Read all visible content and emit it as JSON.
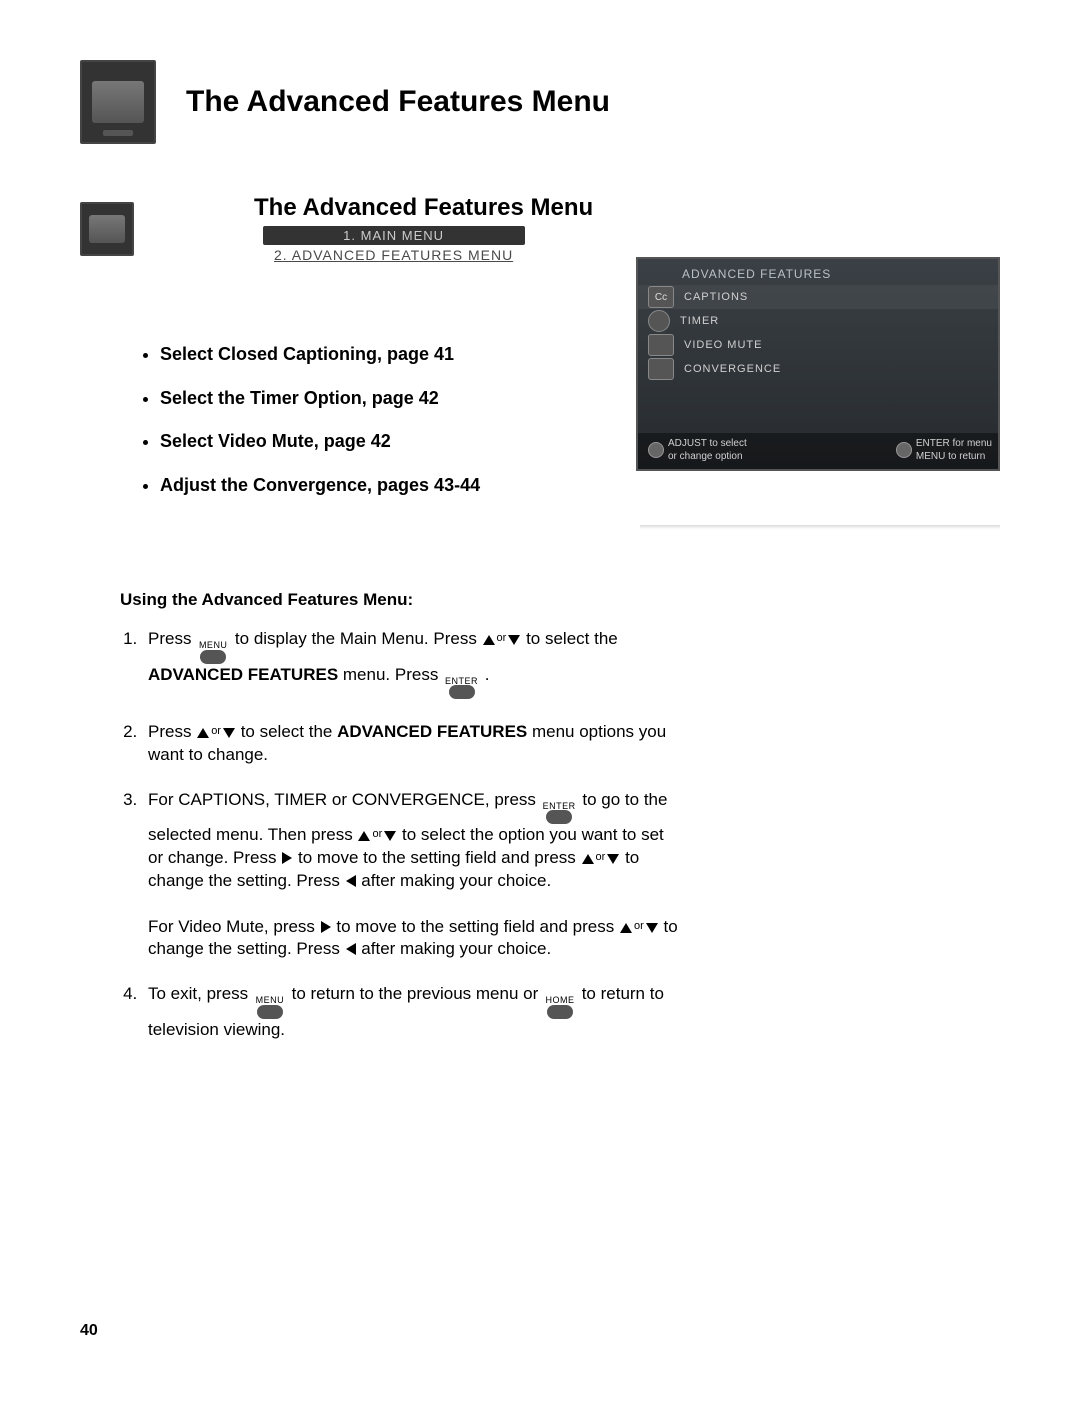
{
  "page": {
    "title": "The Advanced Features Menu",
    "subtitle": "The Advanced Features Menu",
    "breadcrumb": {
      "line1": "1. MAIN MENU",
      "line2": "2. ADVANCED FEATURES MENU"
    },
    "bullets": [
      "Select Closed Captioning, page 41",
      "Select the Timer Option, page 42",
      "Select Video Mute, page 42",
      "Adjust the Convergence, pages 43-44"
    ],
    "osd": {
      "title": "ADVANCED FEATURES",
      "items": [
        {
          "icon": "Cc",
          "label": "CAPTIONS"
        },
        {
          "icon": "",
          "label": "TIMER"
        },
        {
          "icon": "",
          "label": "VIDEO MUTE"
        },
        {
          "icon": "",
          "label": "CONVERGENCE"
        }
      ],
      "footer_left_1": "ADJUST to select",
      "footer_left_2": "or change option",
      "footer_right_1": "ENTER for menu",
      "footer_right_2": "MENU to return"
    },
    "instructions": {
      "heading": "Using the Advanced Features Menu:",
      "buttons": {
        "menu": "MENU",
        "enter": "ENTER",
        "home": "HOME"
      },
      "step1_a": "Press ",
      "step1_b": " to display the Main Menu.  Press ",
      "step1_c": " to select the ",
      "step1_d": "ADVANCED FEATURES",
      "step1_e": " menu. Press ",
      "step1_f": " .",
      "step2_a": "Press ",
      "step2_b": " to select the ",
      "step2_c": "ADVANCED FEATURES",
      "step2_d": " menu options you want to change.",
      "step3_a": "For CAPTIONS, TIMER or CONVERGENCE, press ",
      "step3_b": " to go to the selected menu.  Then press ",
      "step3_c": " to select the option you want to set or change. Press ",
      "step3_d": " to move to the setting field and press ",
      "step3_e": " to change the setting.  Press ",
      "step3_f": " after making your choice.",
      "step3_g": "For Video Mute,  press ",
      "step3_h": " to move to the setting field and press ",
      "step3_i": " to change the setting.  Press ",
      "step3_j": " after making your choice.",
      "step4_a": "To exit, press ",
      "step4_b": " to return to the previous menu or ",
      "step4_c": " to return to television viewing.",
      "or": "or"
    },
    "page_number": "40"
  }
}
